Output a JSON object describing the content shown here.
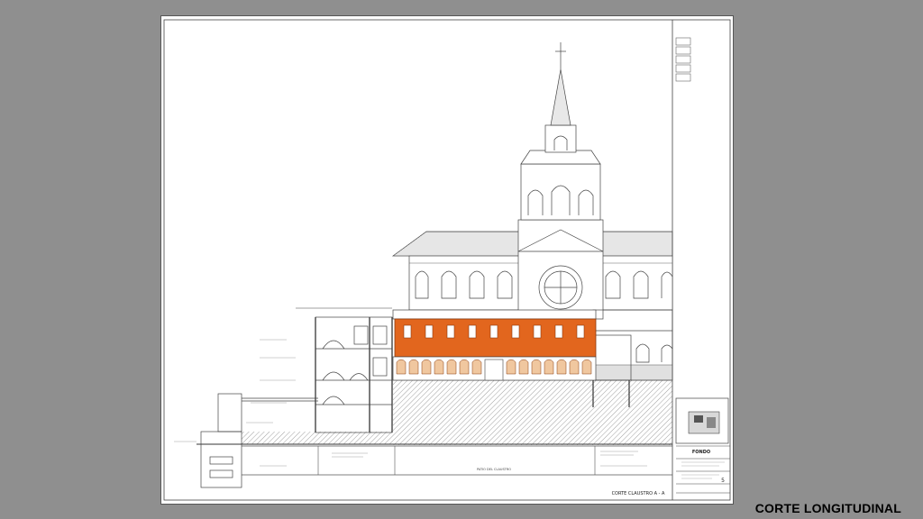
{
  "slide": {
    "caption": "CORTE LONGITUDINAL"
  },
  "sheet": {
    "section_title": "CORTE CLAUSTRO  A - A",
    "sheet_number": "5",
    "title_block_heading": "FONDO",
    "cloister_label": "PATIO DEL CLAUSTRO"
  },
  "colors": {
    "background": "#8f8f8f",
    "paper": "#ffffff",
    "cloister_highlight": "#e2661e",
    "line": "#333333"
  }
}
